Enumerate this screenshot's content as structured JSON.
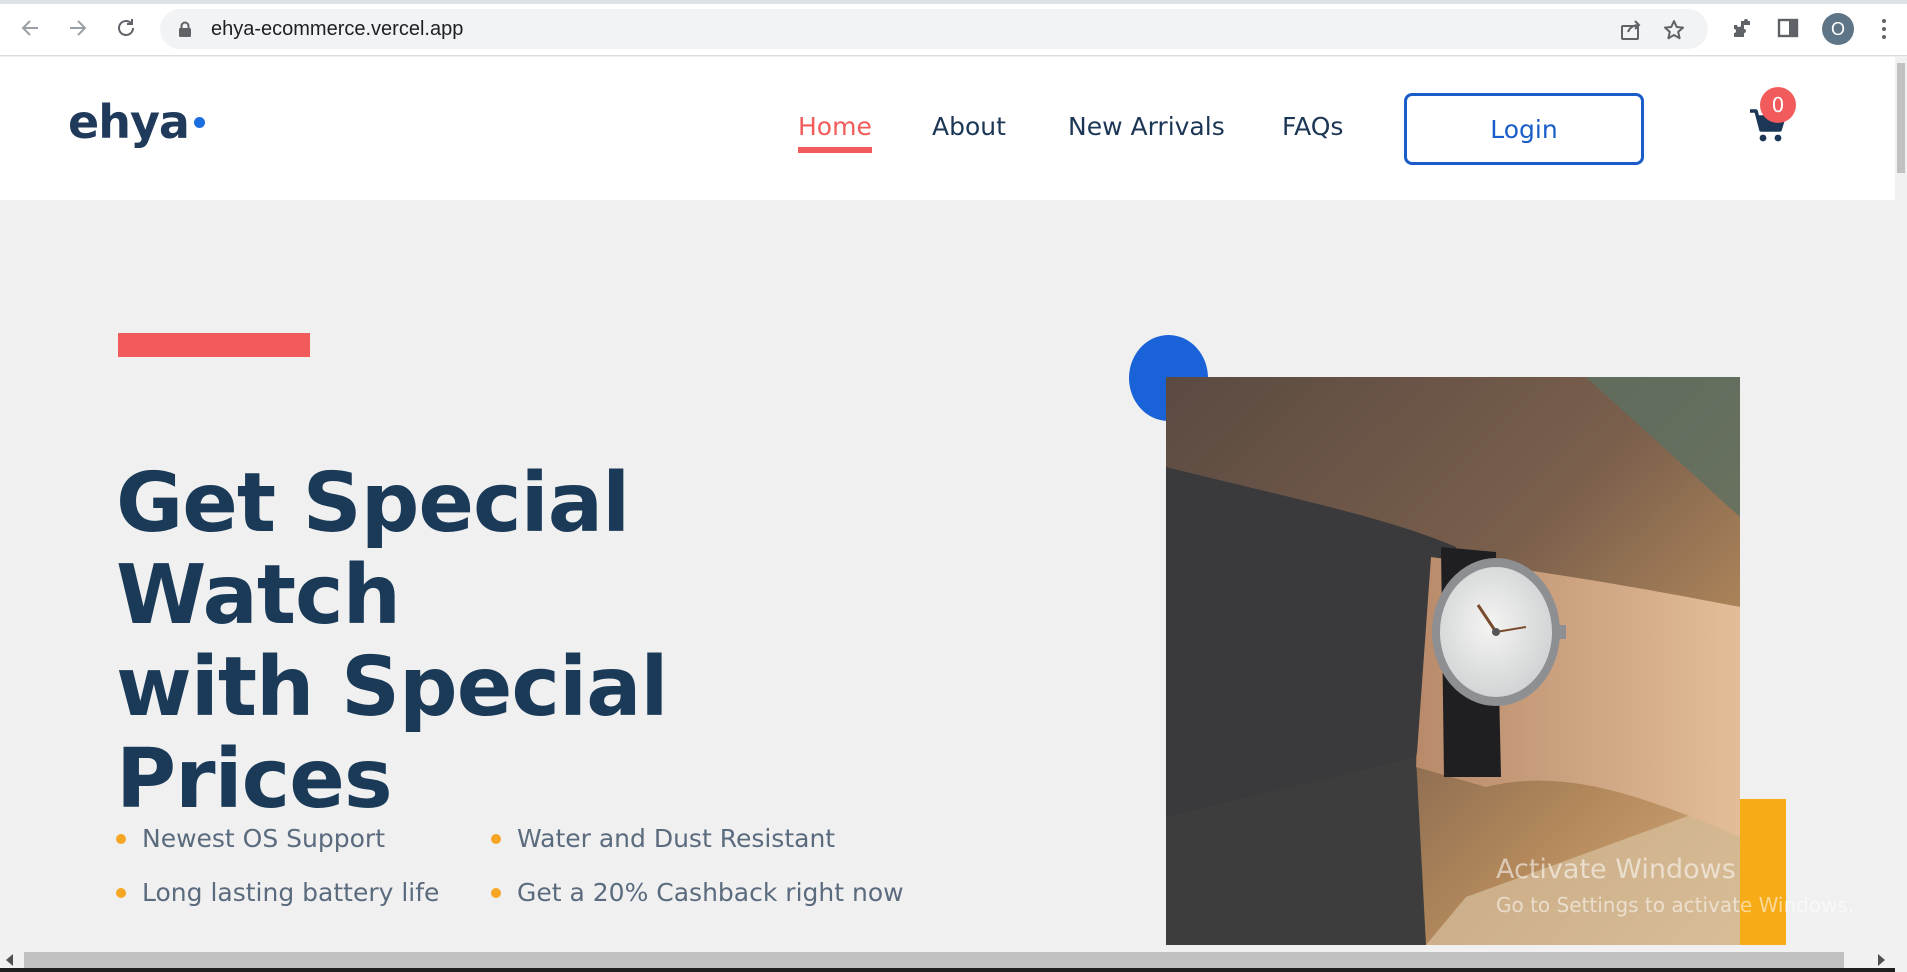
{
  "browser": {
    "url": "ehya-ecommerce.vercel.app",
    "profile_initial": "O",
    "icons": [
      "back-icon",
      "forward-icon",
      "reload-icon",
      "lock-icon",
      "share-icon",
      "star-icon",
      "extensions-icon",
      "side-panel-icon",
      "menu-icon"
    ]
  },
  "header": {
    "logo": "ehya",
    "nav": [
      {
        "label": "Home",
        "active": true
      },
      {
        "label": "About",
        "active": false
      },
      {
        "label": "New Arrivals",
        "active": false
      },
      {
        "label": "FAQs",
        "active": false
      }
    ],
    "login_label": "Login",
    "cart_count": "0"
  },
  "hero": {
    "title_lines": [
      "Get Special Watch",
      "with Special",
      "Prices"
    ],
    "features": [
      "Newest OS Support",
      "Water and Dust Resistant",
      "Long lasting battery life",
      "Get a 20% Cashback right now"
    ],
    "image_alt": "wristwatch-on-wrist-photo"
  },
  "watermark": {
    "line1": "Activate Windows",
    "line2": "Go to Settings to activate Windows."
  },
  "colors": {
    "accent_red": "#f25b5b",
    "accent_blue": "#1a62d8",
    "accent_yellow": "#f7ab16",
    "navy_text": "#1a3a58",
    "hero_bg": "#f0f0f1"
  }
}
